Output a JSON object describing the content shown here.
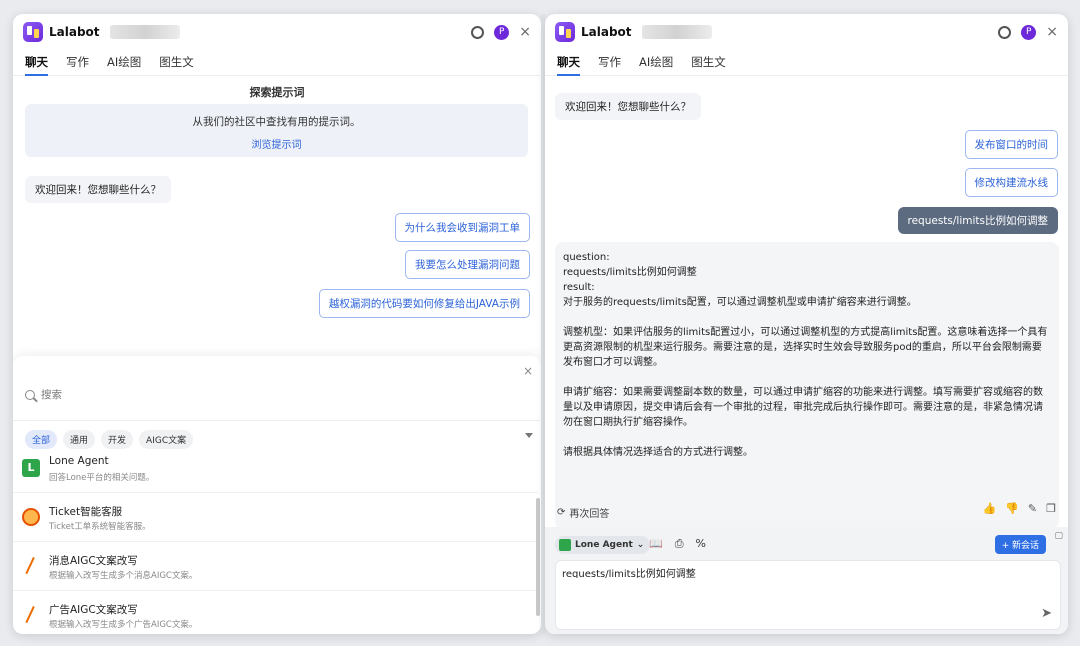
{
  "left": {
    "header": {
      "title": "Lalabot",
      "badge": "P",
      "close": "×"
    },
    "tabs": [
      "聊天",
      "写作",
      "AI绘图",
      "图生文"
    ],
    "explore": {
      "title": "探索提示词",
      "desc": "从我们的社区中查找有用的提示词。",
      "link": "浏览提示词"
    },
    "welcome": "欢迎回来！您想聊些什么？",
    "suggestions": [
      "为什么我会收到漏洞工单",
      "我要怎么处理漏洞问题",
      "越权漏洞的代码要如何修复给出JAVA示例"
    ],
    "drawer": {
      "close": "×",
      "search_placeholder": "搜索",
      "chips": [
        "全部",
        "通用",
        "开发",
        "AIGC文案"
      ],
      "agents": [
        {
          "name": "Lone Agent",
          "desc": "回答Lone平台的相关问题。",
          "icon": "lone-agent-icon"
        },
        {
          "name": "Ticket智能客服",
          "desc": "Ticket工单系统智能客服。",
          "icon": "ticket-robot-icon"
        },
        {
          "name": "消息AIGC文案改写",
          "desc": "根据输入改写生成多个消息AIGC文案。",
          "icon": "pen-icon"
        },
        {
          "name": "广告AIGC文案改写",
          "desc": "根据输入改写生成多个广告AIGC文案。",
          "icon": "pen-icon"
        }
      ]
    }
  },
  "right": {
    "header": {
      "title": "Lalabot",
      "badge": "P",
      "close": "×"
    },
    "tabs": [
      "聊天",
      "写作",
      "AI绘图",
      "图生文"
    ],
    "welcome": "欢迎回来！您想聊些什么？",
    "suggestions": [
      "发布窗口的时间",
      "修改构建流水线"
    ],
    "user_message": "requests/limits比例如何调整",
    "answer": {
      "line1": "question:",
      "line2": "requests/limits比例如何调整",
      "line3": "result:",
      "line4": "对于服务的requests/limits配置，可以通过调整机型或申请扩缩容来进行调整。",
      "para1": "调整机型：如果评估服务的limits配置过小，可以通过调整机型的方式提高limits配置。这意味着选择一个具有更高资源限制的机型来运行服务。需要注意的是，选择实时生效会导致服务pod的重启，所以平台会限制需要发布窗口才可以调整。",
      "para2": "申请扩缩容：如果需要调整副本数的数量，可以通过申请扩缩容的功能来进行调整。填写需要扩容或缩容的数量以及申请原因，提交申请后会有一个审批的过程，审批完成后执行操作即可。需要注意的是，非紧急情况请勿在窗口期执行扩缩容操作。",
      "para3": "请根据具体情况选择适合的方式进行调整。"
    },
    "regenerate": "再次回答",
    "agent_select": "Lone Agent",
    "new_chat": "+ 新会话",
    "input_value": "requests/limits比例如何调整"
  },
  "colors": {
    "accent": "#2f6fe4",
    "user_bubble": "#5c6b80",
    "brand": "#6d28d9"
  }
}
